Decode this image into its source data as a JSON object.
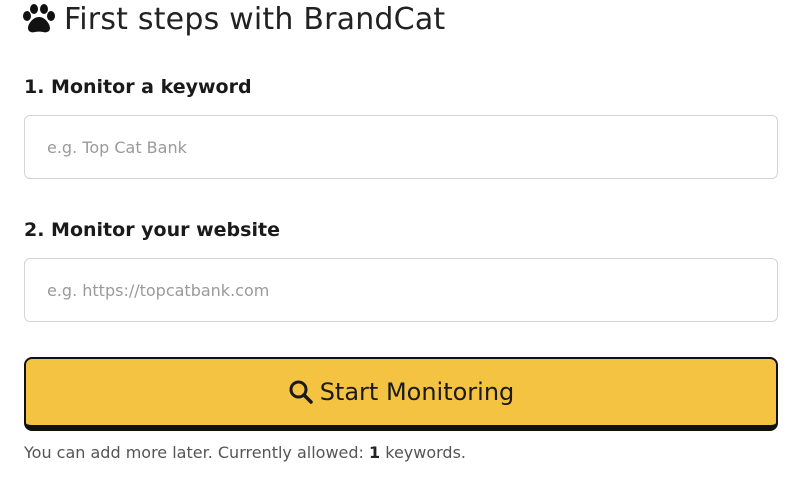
{
  "header": {
    "icon": "paw-icon",
    "title": "First steps with BrandCat"
  },
  "form": {
    "keyword": {
      "label": "1. Monitor a keyword",
      "value": "",
      "placeholder": "e.g. Top Cat Bank"
    },
    "website": {
      "label": "2. Monitor your website",
      "value": "",
      "placeholder": "e.g. https://topcatbank.com"
    },
    "submit": {
      "icon": "search-icon",
      "label": "Start Monitoring"
    }
  },
  "footer": {
    "note_prefix": "You can add more later. Currently allowed: ",
    "allowed_count": "1",
    "note_suffix": " keywords."
  },
  "colors": {
    "button_bg": "#f5c342",
    "button_border": "#111111",
    "field_border": "#d4d4d4"
  }
}
